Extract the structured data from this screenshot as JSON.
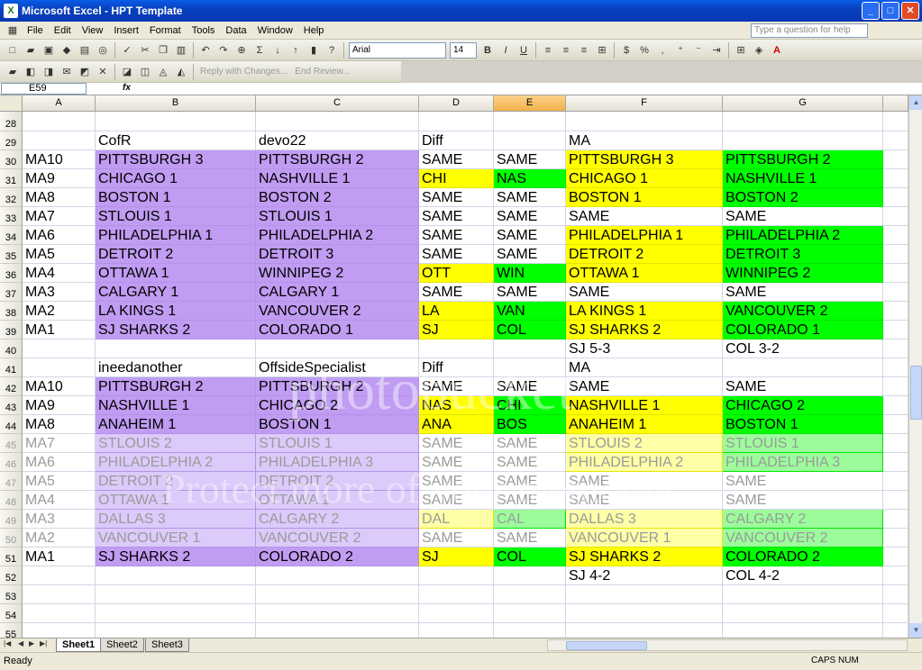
{
  "window": {
    "title": "Microsoft Excel - HPT Template"
  },
  "menu": {
    "items": [
      "File",
      "Edit",
      "View",
      "Insert",
      "Format",
      "Tools",
      "Data",
      "Window",
      "Help"
    ],
    "help_placeholder": "Type a question for help"
  },
  "toolbar": {
    "font": "Arial",
    "size": "14",
    "review_reply": "Reply with Changes...",
    "review_end": "End Review..."
  },
  "formula_bar": {
    "name_box": "E59",
    "fx": "fx",
    "formula": ""
  },
  "columns": [
    {
      "letter": "A"
    },
    {
      "letter": "B"
    },
    {
      "letter": "C"
    },
    {
      "letter": "D"
    },
    {
      "letter": "E",
      "selected": true
    },
    {
      "letter": "F"
    },
    {
      "letter": "G"
    },
    {
      "letter": ""
    }
  ],
  "rows": [
    {
      "num": "28",
      "cells": [
        "",
        "",
        "",
        "",
        "",
        "",
        ""
      ],
      "fill": [
        "",
        "",
        "",
        "",
        "",
        "",
        ""
      ]
    },
    {
      "num": "29",
      "cells": [
        "",
        "CofR",
        "devo22",
        "Diff",
        "",
        "MA",
        ""
      ],
      "fill": [
        "",
        "",
        "",
        "",
        "",
        "",
        ""
      ]
    },
    {
      "num": "30",
      "cells": [
        "MA10",
        "PITTSBURGH 3",
        "PITTSBURGH 2",
        "SAME",
        "SAME",
        "PITTSBURGH 3",
        "PITTSBURGH 2"
      ],
      "fill": [
        "",
        "p",
        "p",
        "",
        "",
        "y",
        "g"
      ]
    },
    {
      "num": "31",
      "cells": [
        "MA9",
        "CHICAGO 1",
        "NASHVILLE 1",
        "CHI",
        "NAS",
        "CHICAGO 1",
        "NASHVILLE 1"
      ],
      "fill": [
        "",
        "p",
        "p",
        "y",
        "g",
        "y",
        "g"
      ]
    },
    {
      "num": "32",
      "cells": [
        "MA8",
        "BOSTON 1",
        "BOSTON 2",
        "SAME",
        "SAME",
        "BOSTON 1",
        "BOSTON 2"
      ],
      "fill": [
        "",
        "p",
        "p",
        "",
        "",
        "y",
        "g"
      ]
    },
    {
      "num": "33",
      "cells": [
        "MA7",
        "STLOUIS 1",
        "STLOUIS 1",
        "SAME",
        "SAME",
        "SAME",
        "SAME"
      ],
      "fill": [
        "",
        "p",
        "p",
        "",
        "",
        "",
        ""
      ]
    },
    {
      "num": "34",
      "cells": [
        "MA6",
        "PHILADELPHIA 1",
        "PHILADELPHIA 2",
        "SAME",
        "SAME",
        "PHILADELPHIA 1",
        "PHILADELPHIA 2"
      ],
      "fill": [
        "",
        "p",
        "p",
        "",
        "",
        "y",
        "g"
      ]
    },
    {
      "num": "35",
      "cells": [
        "MA5",
        "DETROIT 2",
        "DETROIT 3",
        "SAME",
        "SAME",
        "DETROIT 2",
        "DETROIT 3"
      ],
      "fill": [
        "",
        "p",
        "p",
        "",
        "",
        "y",
        "g"
      ]
    },
    {
      "num": "36",
      "cells": [
        "MA4",
        "OTTAWA 1",
        "WINNIPEG 2",
        "OTT",
        "WIN",
        "OTTAWA 1",
        "WINNIPEG 2"
      ],
      "fill": [
        "",
        "p",
        "p",
        "y",
        "g",
        "y",
        "g"
      ]
    },
    {
      "num": "37",
      "cells": [
        "MA3",
        "CALGARY 1",
        "CALGARY 1",
        "SAME",
        "SAME",
        "SAME",
        "SAME"
      ],
      "fill": [
        "",
        "p",
        "p",
        "",
        "",
        "",
        ""
      ]
    },
    {
      "num": "38",
      "cells": [
        "MA2",
        "LA KINGS 1",
        "VANCOUVER 2",
        "LA",
        "VAN",
        "LA KINGS 1",
        "VANCOUVER 2"
      ],
      "fill": [
        "",
        "p",
        "p",
        "y",
        "g",
        "y",
        "g"
      ]
    },
    {
      "num": "39",
      "cells": [
        "MA1",
        "SJ SHARKS 2",
        "COLORADO 1",
        "SJ",
        "COL",
        "SJ SHARKS 2",
        "COLORADO 1"
      ],
      "fill": [
        "",
        "p",
        "p",
        "y",
        "g",
        "y",
        "g"
      ]
    },
    {
      "num": "40",
      "cells": [
        "",
        "",
        "",
        "",
        "",
        "SJ 5-3",
        "COL 3-2"
      ],
      "fill": [
        "",
        "",
        "",
        "",
        "",
        "",
        ""
      ]
    },
    {
      "num": "41",
      "cells": [
        "",
        "ineedanother",
        "OffsideSpecialist",
        "Diff",
        "",
        "MA",
        ""
      ],
      "fill": [
        "",
        "",
        "",
        "",
        "",
        "",
        ""
      ]
    },
    {
      "num": "42",
      "cells": [
        "MA10",
        "PITTSBURGH 2",
        "PITTSBURGH 2",
        "SAME",
        "SAME",
        "SAME",
        "SAME"
      ],
      "fill": [
        "",
        "p",
        "p",
        "",
        "",
        "",
        ""
      ]
    },
    {
      "num": "43",
      "cells": [
        "MA9",
        "NASHVILLE 1",
        "CHICAGO 2",
        "NAS",
        "CHI",
        "NASHVILLE 1",
        "CHICAGO 2"
      ],
      "fill": [
        "",
        "p",
        "p",
        "y",
        "g",
        "y",
        "g"
      ]
    },
    {
      "num": "44",
      "cells": [
        "MA8",
        "ANAHEIM 1",
        "BOSTON 1",
        "ANA",
        "BOS",
        "ANAHEIM 1",
        "BOSTON 1"
      ],
      "fill": [
        "",
        "p",
        "p",
        "y",
        "g",
        "y",
        "g"
      ]
    },
    {
      "num": "45",
      "faded": true,
      "cells": [
        "MA7",
        "STLOUIS 2",
        "STLOUIS 1",
        "SAME",
        "SAME",
        "STLOUIS 2",
        "STLOUIS 1"
      ],
      "fill": [
        "",
        "p",
        "p",
        "",
        "",
        "y",
        "g"
      ]
    },
    {
      "num": "46",
      "faded": true,
      "cells": [
        "MA6",
        "PHILADELPHIA 2",
        "PHILADELPHIA 3",
        "SAME",
        "SAME",
        "PHILADELPHIA 2",
        "PHILADELPHIA 3"
      ],
      "fill": [
        "",
        "p",
        "p",
        "",
        "",
        "y",
        "g"
      ]
    },
    {
      "num": "47",
      "faded": true,
      "cells": [
        "MA5",
        "DETROIT 2",
        "DETROIT 2",
        "SAME",
        "SAME",
        "SAME",
        "SAME"
      ],
      "fill": [
        "",
        "p",
        "p",
        "",
        "",
        "",
        ""
      ]
    },
    {
      "num": "48",
      "faded": true,
      "cells": [
        "MA4",
        "OTTAWA 1",
        "OTTAWA 1",
        "SAME",
        "SAME",
        "SAME",
        "SAME"
      ],
      "fill": [
        "",
        "p",
        "p",
        "",
        "",
        "",
        ""
      ]
    },
    {
      "num": "49",
      "faded": true,
      "cells": [
        "MA3",
        "DALLAS 3",
        "CALGARY 2",
        "DAL",
        "CAL",
        "DALLAS 3",
        "CALGARY 2"
      ],
      "fill": [
        "",
        "p",
        "p",
        "y",
        "g",
        "y",
        "g"
      ]
    },
    {
      "num": "50",
      "faded": true,
      "cells": [
        "MA2",
        "VANCOUVER 1",
        "VANCOUVER 2",
        "SAME",
        "SAME",
        "VANCOUVER 1",
        "VANCOUVER 2"
      ],
      "fill": [
        "",
        "p",
        "p",
        "",
        "",
        "y",
        "g"
      ]
    },
    {
      "num": "51",
      "cells": [
        "MA1",
        "SJ SHARKS 2",
        "COLORADO 2",
        "SJ",
        "COL",
        "SJ SHARKS 2",
        "COLORADO 2"
      ],
      "fill": [
        "",
        "p",
        "p",
        "y",
        "g",
        "y",
        "g"
      ]
    },
    {
      "num": "52",
      "cells": [
        "",
        "",
        "",
        "",
        "",
        "SJ 4-2",
        "COL 4-2"
      ],
      "fill": [
        "",
        "",
        "",
        "",
        "",
        "",
        ""
      ]
    },
    {
      "num": "53",
      "cells": [
        "",
        "",
        "",
        "",
        "",
        "",
        ""
      ],
      "fill": [
        "",
        "",
        "",
        "",
        "",
        "",
        ""
      ]
    },
    {
      "num": "54",
      "cells": [
        "",
        "",
        "",
        "",
        "",
        "",
        ""
      ],
      "fill": [
        "",
        "",
        "",
        "",
        "",
        "",
        ""
      ]
    },
    {
      "num": "55",
      "cells": [
        "",
        "",
        "",
        "",
        "",
        "",
        ""
      ],
      "fill": [
        "",
        "",
        "",
        "",
        "",
        "",
        ""
      ]
    }
  ],
  "sheets": [
    {
      "label": "Sheet1",
      "active": true
    },
    {
      "label": "Sheet2"
    },
    {
      "label": "Sheet3"
    }
  ],
  "status": {
    "text": "Ready",
    "caps": "CAPS",
    "num": "NUM"
  },
  "watermark": {
    "line1": "photobucket",
    "line2": "Protect more of your memories"
  },
  "colors": {
    "purple": "#c09cf2",
    "yellow": "#ffff00",
    "green": "#00ff00",
    "title_blue": "#0842c0"
  }
}
